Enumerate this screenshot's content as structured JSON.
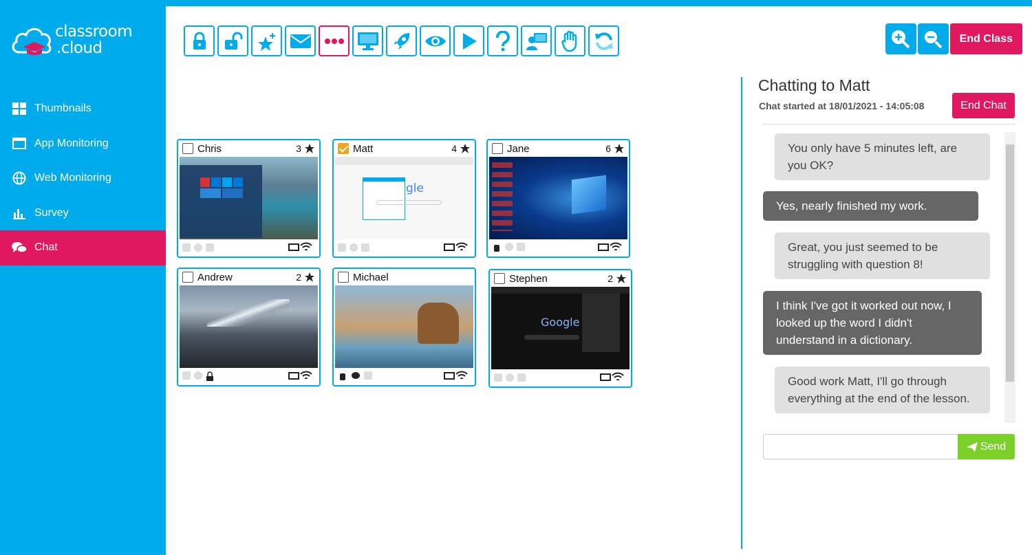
{
  "brand": {
    "logo_line1": "classroom",
    "logo_line2": ".cloud"
  },
  "colors": {
    "accent": "#00abec",
    "pink": "#e0185f",
    "send": "#7dcf2a"
  },
  "sidebar": {
    "items": [
      {
        "label": "Thumbnails",
        "icon": "grid-icon"
      },
      {
        "label": "App Monitoring",
        "icon": "window-icon"
      },
      {
        "label": "Web Monitoring",
        "icon": "globe-icon"
      },
      {
        "label": "Survey",
        "icon": "bar-chart-icon"
      },
      {
        "label": "Chat",
        "icon": "chat-icon",
        "active": true
      }
    ]
  },
  "toolbar": {
    "buttons": [
      "lock-icon",
      "unlock-icon",
      "star-award-icon",
      "envelope-icon",
      "dots-icon",
      "monitor-icon",
      "rocket-icon",
      "eye-icon",
      "play-icon",
      "question-icon",
      "presenter-icon",
      "hand-icon",
      "refresh-icon"
    ],
    "zoom_in": "zoom-in-icon",
    "zoom_out": "zoom-out-icon",
    "end_class": "End Class"
  },
  "students": [
    {
      "name": "Chris",
      "count": "3",
      "checked": false
    },
    {
      "name": "Matt",
      "count": "4",
      "checked": true
    },
    {
      "name": "Jane",
      "count": "6",
      "checked": false
    },
    {
      "name": "Andrew",
      "count": "2",
      "checked": false
    },
    {
      "name": "Michael",
      "count": "",
      "checked": false
    },
    {
      "name": "Stephen",
      "count": "2",
      "checked": false
    }
  ],
  "chat": {
    "title": "Chatting to Matt",
    "started": "Chat started at 18/01/2021 - 14:05:08",
    "end_chat": "End Chat",
    "messages": [
      {
        "from": "teacher",
        "text": "You only have 5 minutes left, are you OK?"
      },
      {
        "from": "student",
        "text": "Yes, nearly finished my work."
      },
      {
        "from": "teacher",
        "text": "Great, you just seemed to be struggling with question 8!"
      },
      {
        "from": "student",
        "text": "I think I've got it worked out now, I looked up the word I didn't understand in a dictionary."
      },
      {
        "from": "teacher",
        "text": "Good work Matt, I'll go through everything at the end of the lesson."
      }
    ],
    "input_placeholder": "",
    "send_label": "Send"
  }
}
